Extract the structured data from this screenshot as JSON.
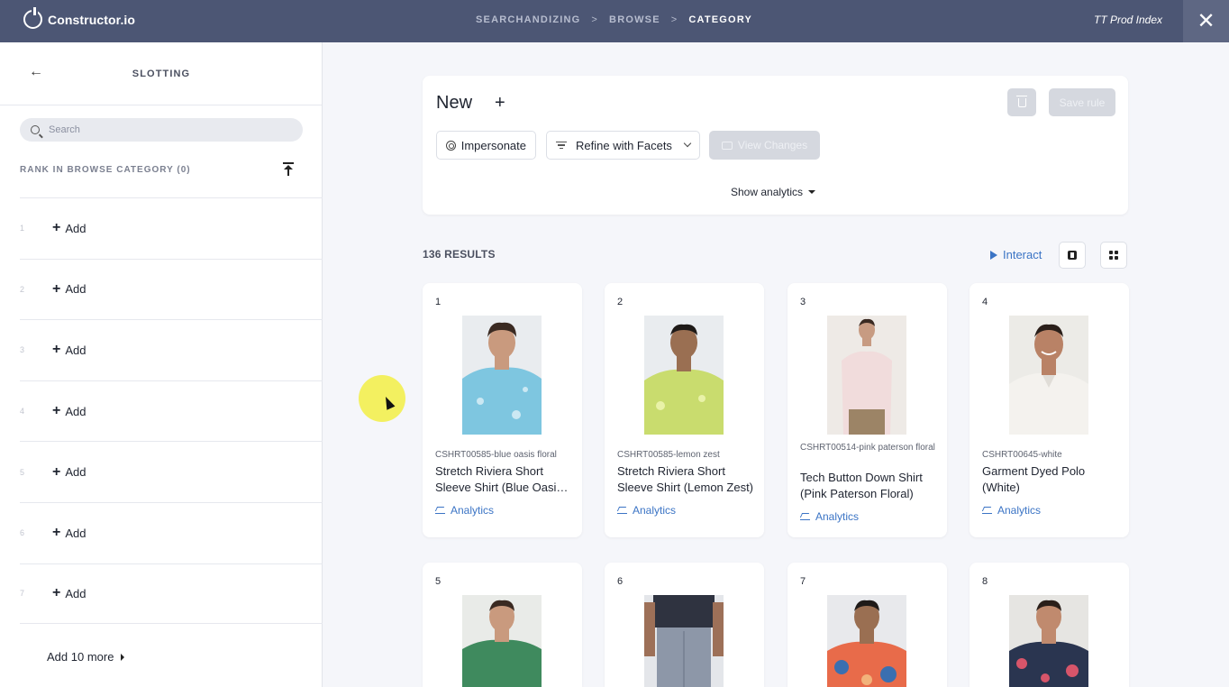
{
  "topbar": {
    "logo_text": "Constructor.io",
    "breadcrumbs": [
      "SEARCHANDIZING",
      "BROWSE",
      "CATEGORY"
    ],
    "index_name": "TT Prod Index",
    "close_symbol": "✕"
  },
  "sidebar": {
    "title": "SLOTTING",
    "search_placeholder": "Search",
    "rank_header": "RANK IN BROWSE CATEGORY (0)",
    "slots": [
      {
        "num": "1",
        "label": "Add"
      },
      {
        "num": "2",
        "label": "Add"
      },
      {
        "num": "3",
        "label": "Add"
      },
      {
        "num": "4",
        "label": "Add"
      },
      {
        "num": "5",
        "label": "Add"
      },
      {
        "num": "6",
        "label": "Add"
      },
      {
        "num": "7",
        "label": "Add"
      }
    ],
    "add_more": "Add 10 more"
  },
  "rule": {
    "title": "New",
    "save_label": "Save rule",
    "impersonate_label": "Impersonate",
    "refine_label": "Refine with Facets",
    "view_changes_label": "View Changes",
    "show_analytics_label": "Show analytics"
  },
  "results": {
    "count_label": "136 RESULTS",
    "interact_label": "Interact",
    "products": [
      {
        "num": "1",
        "sku": "CSHRT00585-blue oasis floral",
        "name": "Stretch Riviera Short Sleeve Shirt (Blue Oasis Floral)",
        "analytics": "Analytics",
        "shirt_color": "#7ec6e0",
        "accent": "#ffffff"
      },
      {
        "num": "2",
        "sku": "CSHRT00585-lemon zest",
        "name": "Stretch Riviera Short Sleeve Shirt (Lemon Zest)",
        "analytics": "Analytics",
        "shirt_color": "#c9dc6e",
        "accent": "#e9f2a8"
      },
      {
        "num": "3",
        "sku": "CSHRT00514-pink paterson floral",
        "name": "Tech Button Down Shirt (Pink Paterson Floral)",
        "analytics": "Analytics",
        "shirt_color": "#f1dcdc",
        "accent": "#ffffff"
      },
      {
        "num": "4",
        "sku": "CSHRT00645-white",
        "name": "Garment Dyed Polo (White)",
        "analytics": "Analytics",
        "shirt_color": "#f4f2ee",
        "accent": "#ffffff"
      },
      {
        "num": "5",
        "sku": "",
        "name": "",
        "analytics": "",
        "shirt_color": "#3f8a5e",
        "accent": "#3f8a5e"
      },
      {
        "num": "6",
        "sku": "",
        "name": "",
        "analytics": "",
        "shirt_color": "#2f3340",
        "accent": "#8d97a8"
      },
      {
        "num": "7",
        "sku": "",
        "name": "",
        "analytics": "",
        "shirt_color": "#e86b4a",
        "accent": "#3a6fb0"
      },
      {
        "num": "8",
        "sku": "",
        "name": "",
        "analytics": "",
        "shirt_color": "#2a3550",
        "accent": "#d7556a"
      }
    ]
  },
  "colors": {
    "topbar": "#4c5674",
    "accent_blue": "#3b74c5",
    "cursor_highlight": "#f3ef4f"
  }
}
